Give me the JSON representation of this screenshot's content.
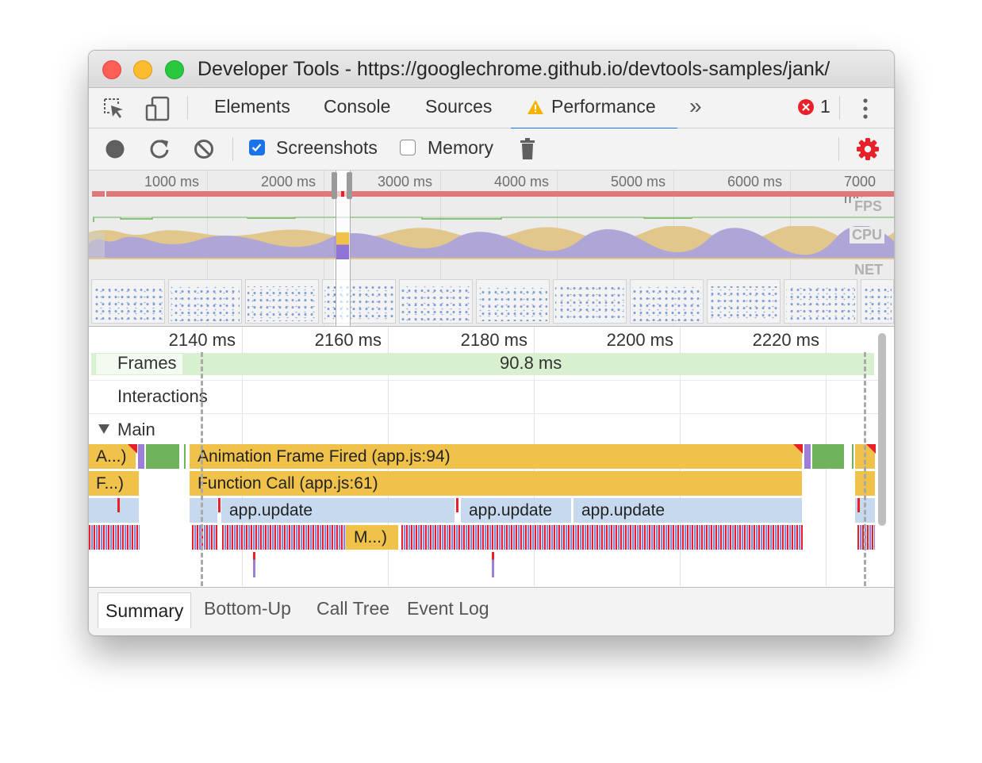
{
  "window": {
    "title": "Developer Tools - https://googlechrome.github.io/devtools-samples/jank/"
  },
  "tabs": {
    "items": [
      "Elements",
      "Console",
      "Sources",
      "Performance"
    ],
    "more": "»",
    "error_count": "1",
    "active": "Performance"
  },
  "toolbar": {
    "screenshots_label": "Screenshots",
    "screenshots_checked": true,
    "memory_label": "Memory",
    "memory_checked": false
  },
  "overview": {
    "ticks": [
      "1000 ms",
      "2000 ms",
      "3000 ms",
      "4000 ms",
      "5000 ms",
      "6000 ms",
      "7000 ms"
    ],
    "tracks": [
      "FPS",
      "CPU",
      "NET"
    ]
  },
  "timeline": {
    "ticks": [
      "2140 ms",
      "2160 ms",
      "2180 ms",
      "2200 ms",
      "2220 ms"
    ],
    "frames_label": "Frames",
    "frame_duration": "90.8 ms",
    "interactions_label": "Interactions",
    "main_label": "Main"
  },
  "flame": {
    "row1": {
      "short": "A...)",
      "main": "Animation Frame Fired (app.js:94)"
    },
    "row2": {
      "short": "F...)",
      "main": "Function Call (app.js:61)"
    },
    "row3": {
      "items": [
        "app.update",
        "app.update",
        "app.update"
      ]
    },
    "row4": {
      "short": "M...)"
    }
  },
  "bottom_tabs": [
    "Summary",
    "Bottom-Up",
    "Call Tree",
    "Event Log"
  ],
  "colors": {
    "scripting": "#f0c24a",
    "function": "#c6d9ee",
    "painting": "#6fb35f",
    "rendering": "#9b7fd6",
    "warning": "#e8202a",
    "accent": "#1a73e8"
  }
}
